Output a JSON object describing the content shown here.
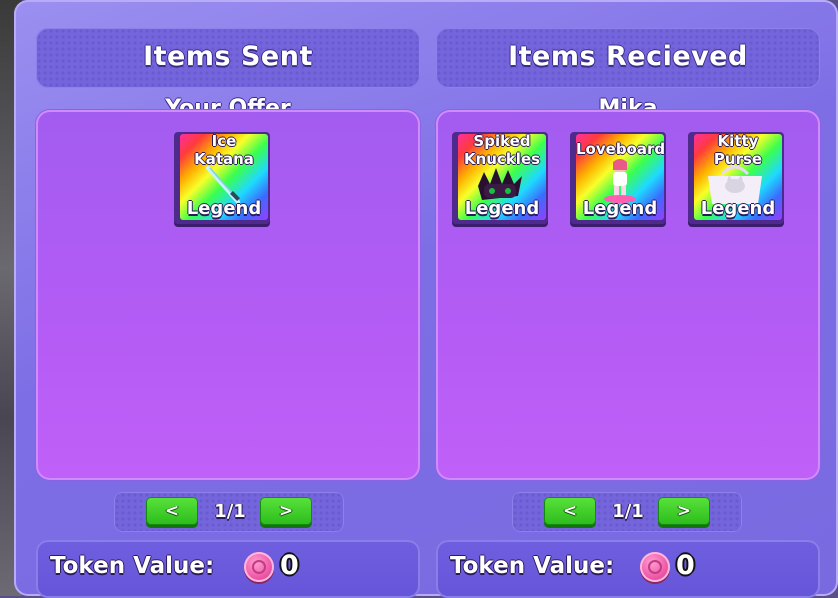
{
  "sent": {
    "header": "Items Sent",
    "subtitle": "Your Offer",
    "items": [
      {
        "name_line1": "Ice",
        "name_line2": "Katana",
        "rarity": "Legend"
      }
    ],
    "page": "1/1",
    "prev_label": "<",
    "next_label": ">",
    "token_label": "Token Value:",
    "token_value": "0"
  },
  "received": {
    "header": "Items Recieved",
    "subtitle": "Mika",
    "items": [
      {
        "name_line1": "Spiked",
        "name_line2": "Knuckles",
        "rarity": "Legend"
      },
      {
        "name_line1": "Loveboard",
        "name_line2": "",
        "rarity": "Legend"
      },
      {
        "name_line1": "Kitty",
        "name_line2": "Purse",
        "rarity": "Legend"
      }
    ],
    "page": "1/1",
    "prev_label": "<",
    "next_label": ">",
    "token_label": "Token Value:",
    "token_value": "0"
  },
  "colors": {
    "accent_green": "#2cbc1c",
    "panel_purple": "#7465dc",
    "offer_purple": "#b45cf5",
    "coin_pink": "#f05aa8"
  },
  "icons": {
    "token": "pink-token-coin-icon",
    "prev": "left-chevron",
    "next": "right-chevron"
  }
}
